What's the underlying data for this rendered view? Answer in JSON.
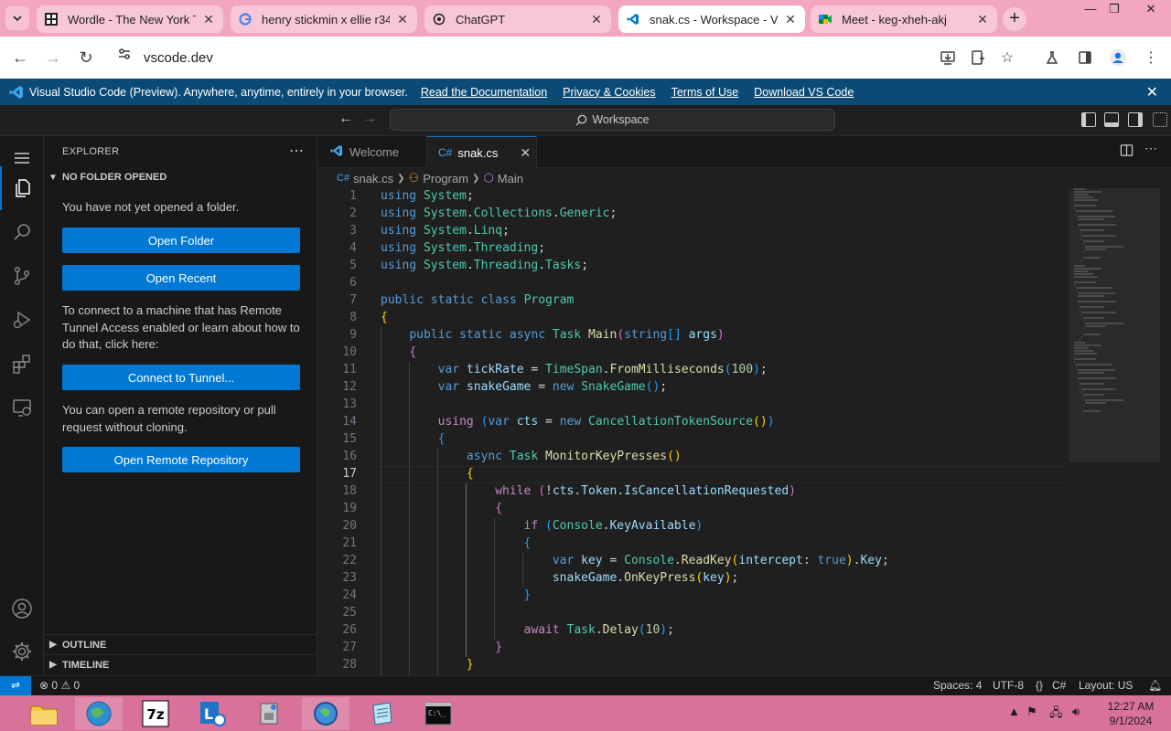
{
  "browser": {
    "tabs": [
      {
        "title": "Wordle - The New York Ti",
        "icon": "wordle-icon"
      },
      {
        "title": "henry stickmin x ellie r34",
        "icon": "google-icon"
      },
      {
        "title": "ChatGPT",
        "icon": "chatgpt-icon"
      },
      {
        "title": "snak.cs - Workspace - Vis",
        "icon": "vscode-icon"
      },
      {
        "title": "Meet - keg-xheh-akj",
        "icon": "meet-icon"
      }
    ],
    "url": "vscode.dev"
  },
  "banner": {
    "message": "Visual Studio Code (Preview). Anywhere, anytime, entirely in your browser.",
    "links": [
      "Read the Documentation",
      "Privacy & Cookies",
      "Terms of Use",
      "Download VS Code"
    ]
  },
  "titlebar": {
    "search": "Workspace"
  },
  "sidebar": {
    "title": "EXPLORER",
    "section": "NO FOLDER OPENED",
    "no_folder_text": "You have not yet opened a folder.",
    "open_folder": "Open Folder",
    "open_recent": "Open Recent",
    "tunnel_text": "To connect to a machine that has Remote Tunnel Access enabled or learn about how to do that, click here:",
    "connect_tunnel": "Connect to Tunnel...",
    "remote_text": "You can open a remote repository or pull request without cloning.",
    "open_remote": "Open Remote Repository",
    "outline": "OUTLINE",
    "timeline": "TIMELINE"
  },
  "editor": {
    "tabs": [
      {
        "label": "Welcome"
      },
      {
        "label": "snak.cs"
      }
    ],
    "breadcrumbs": [
      "snak.cs",
      "Program",
      "Main"
    ],
    "current_line": 17,
    "lines": [
      [
        [
          "k",
          "using"
        ],
        [
          "p",
          " "
        ],
        [
          "t",
          "System"
        ],
        [
          "p",
          ";"
        ]
      ],
      [
        [
          "k",
          "using"
        ],
        [
          "p",
          " "
        ],
        [
          "t",
          "System"
        ],
        [
          "p",
          "."
        ],
        [
          "t",
          "Collections"
        ],
        [
          "p",
          "."
        ],
        [
          "t",
          "Generic"
        ],
        [
          "p",
          ";"
        ]
      ],
      [
        [
          "k",
          "using"
        ],
        [
          "p",
          " "
        ],
        [
          "t",
          "System"
        ],
        [
          "p",
          "."
        ],
        [
          "t",
          "Linq"
        ],
        [
          "p",
          ";"
        ]
      ],
      [
        [
          "k",
          "using"
        ],
        [
          "p",
          " "
        ],
        [
          "t",
          "System"
        ],
        [
          "p",
          "."
        ],
        [
          "t",
          "Threading"
        ],
        [
          "p",
          ";"
        ]
      ],
      [
        [
          "k",
          "using"
        ],
        [
          "p",
          " "
        ],
        [
          "t",
          "System"
        ],
        [
          "p",
          "."
        ],
        [
          "t",
          "Threading"
        ],
        [
          "p",
          "."
        ],
        [
          "t",
          "Tasks"
        ],
        [
          "p",
          ";"
        ]
      ],
      [],
      [
        [
          "k",
          "public"
        ],
        [
          "p",
          " "
        ],
        [
          "k",
          "static"
        ],
        [
          "p",
          " "
        ],
        [
          "k",
          "class"
        ],
        [
          "p",
          " "
        ],
        [
          "t",
          "Program"
        ]
      ],
      [
        [
          "b1",
          "{"
        ]
      ],
      [
        [
          "p",
          "    "
        ],
        [
          "k",
          "public"
        ],
        [
          "p",
          " "
        ],
        [
          "k",
          "static"
        ],
        [
          "p",
          " "
        ],
        [
          "k",
          "async"
        ],
        [
          "p",
          " "
        ],
        [
          "t",
          "Task"
        ],
        [
          "p",
          " "
        ],
        [
          "f",
          "Main"
        ],
        [
          "b2",
          "("
        ],
        [
          "k",
          "string"
        ],
        [
          "b3",
          "[]"
        ],
        [
          "p",
          " "
        ],
        [
          "v",
          "args"
        ],
        [
          "b2",
          ")"
        ]
      ],
      [
        [
          "p",
          "    "
        ],
        [
          "b2",
          "{"
        ]
      ],
      [
        [
          "p",
          "        "
        ],
        [
          "k",
          "var"
        ],
        [
          "p",
          " "
        ],
        [
          "v",
          "tickRate"
        ],
        [
          "p",
          " = "
        ],
        [
          "t",
          "TimeSpan"
        ],
        [
          "p",
          "."
        ],
        [
          "f",
          "FromMilliseconds"
        ],
        [
          "b3",
          "("
        ],
        [
          "n",
          "100"
        ],
        [
          "b3",
          ")"
        ],
        [
          "p",
          ";"
        ]
      ],
      [
        [
          "p",
          "        "
        ],
        [
          "k",
          "var"
        ],
        [
          "p",
          " "
        ],
        [
          "v",
          "snakeGame"
        ],
        [
          "p",
          " = "
        ],
        [
          "k",
          "new"
        ],
        [
          "p",
          " "
        ],
        [
          "t",
          "SnakeGame"
        ],
        [
          "b3",
          "()"
        ],
        [
          "p",
          ";"
        ]
      ],
      [],
      [
        [
          "p",
          "        "
        ],
        [
          "c",
          "using"
        ],
        [
          "p",
          " "
        ],
        [
          "b3",
          "("
        ],
        [
          "k",
          "var"
        ],
        [
          "p",
          " "
        ],
        [
          "v",
          "cts"
        ],
        [
          "p",
          " = "
        ],
        [
          "k",
          "new"
        ],
        [
          "p",
          " "
        ],
        [
          "t",
          "CancellationTokenSource"
        ],
        [
          "b1",
          "()"
        ],
        [
          "b3",
          ")"
        ]
      ],
      [
        [
          "p",
          "        "
        ],
        [
          "b3",
          "{"
        ]
      ],
      [
        [
          "p",
          "            "
        ],
        [
          "k",
          "async"
        ],
        [
          "p",
          " "
        ],
        [
          "t",
          "Task"
        ],
        [
          "p",
          " "
        ],
        [
          "f",
          "MonitorKeyPresses"
        ],
        [
          "b1",
          "()"
        ]
      ],
      [
        [
          "p",
          "            "
        ],
        [
          "b1",
          "{"
        ]
      ],
      [
        [
          "p",
          "                "
        ],
        [
          "c",
          "while"
        ],
        [
          "p",
          " "
        ],
        [
          "b2",
          "("
        ],
        [
          "p",
          "!"
        ],
        [
          "v",
          "cts"
        ],
        [
          "p",
          "."
        ],
        [
          "v",
          "Token"
        ],
        [
          "p",
          "."
        ],
        [
          "v",
          "IsCancellationRequested"
        ],
        [
          "b2",
          ")"
        ]
      ],
      [
        [
          "p",
          "                "
        ],
        [
          "b2",
          "{"
        ]
      ],
      [
        [
          "p",
          "                    "
        ],
        [
          "c",
          "if"
        ],
        [
          "p",
          " "
        ],
        [
          "b3",
          "("
        ],
        [
          "t",
          "Console"
        ],
        [
          "p",
          "."
        ],
        [
          "v",
          "KeyAvailable"
        ],
        [
          "b3",
          ")"
        ]
      ],
      [
        [
          "p",
          "                    "
        ],
        [
          "b3",
          "{"
        ]
      ],
      [
        [
          "p",
          "                        "
        ],
        [
          "k",
          "var"
        ],
        [
          "p",
          " "
        ],
        [
          "v",
          "key"
        ],
        [
          "p",
          " = "
        ],
        [
          "t",
          "Console"
        ],
        [
          "p",
          "."
        ],
        [
          "f",
          "ReadKey"
        ],
        [
          "b1",
          "("
        ],
        [
          "v",
          "intercept"
        ],
        [
          "p",
          ": "
        ],
        [
          "k",
          "true"
        ],
        [
          "b1",
          ")"
        ],
        [
          "p",
          "."
        ],
        [
          "v",
          "Key"
        ],
        [
          "p",
          ";"
        ]
      ],
      [
        [
          "p",
          "                        "
        ],
        [
          "v",
          "snakeGame"
        ],
        [
          "p",
          "."
        ],
        [
          "f",
          "OnKeyPress"
        ],
        [
          "b1",
          "("
        ],
        [
          "v",
          "key"
        ],
        [
          "b1",
          ")"
        ],
        [
          "p",
          ";"
        ]
      ],
      [
        [
          "p",
          "                    "
        ],
        [
          "b3",
          "}"
        ]
      ],
      [],
      [
        [
          "p",
          "                    "
        ],
        [
          "c",
          "await"
        ],
        [
          "p",
          " "
        ],
        [
          "t",
          "Task"
        ],
        [
          "p",
          "."
        ],
        [
          "f",
          "Delay"
        ],
        [
          "b3",
          "("
        ],
        [
          "n",
          "10"
        ],
        [
          "b3",
          ")"
        ],
        [
          "p",
          ";"
        ]
      ],
      [
        [
          "p",
          "                "
        ],
        [
          "b2",
          "}"
        ]
      ],
      [
        [
          "p",
          "            "
        ],
        [
          "b1",
          "}"
        ]
      ]
    ]
  },
  "status": {
    "errors": "0",
    "warnings": "0",
    "spaces": "Spaces: 4",
    "encoding": "UTF-8",
    "language": "C#",
    "layout": "Layout: US"
  },
  "taskbar": {
    "apps": [
      "file-explorer",
      "browser",
      "7zip",
      "lync",
      "installer",
      "network",
      "notepad",
      "terminal"
    ],
    "time": "12:27 AM",
    "date": "9/1/2024"
  },
  "colors": {
    "accent": "#0078d4",
    "banner": "#0b4a75",
    "browser_frame": "#f2a6c0",
    "taskbar": "#d8729a"
  }
}
